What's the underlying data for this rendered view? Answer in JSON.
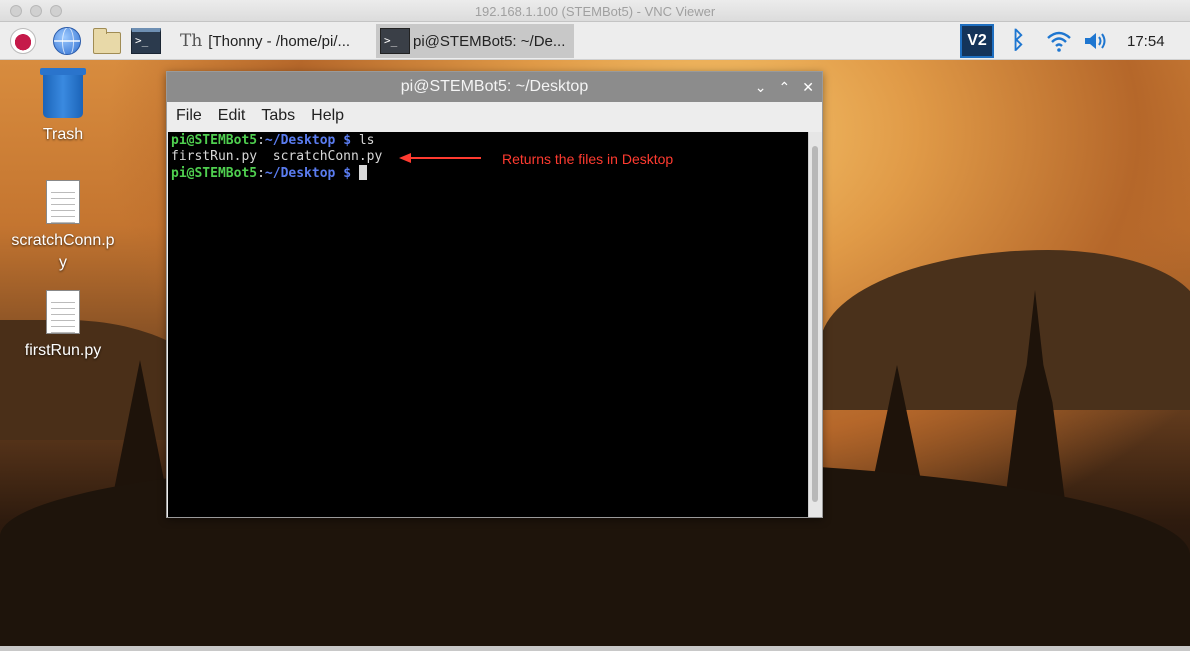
{
  "vnc": {
    "title": "192.168.1.100 (STEMBot5) - VNC Viewer"
  },
  "taskbar": {
    "icons": [
      "raspberry-menu-icon",
      "web-browser-icon",
      "file-manager-icon",
      "terminal-icon"
    ],
    "tasks": [
      {
        "label": "[Thonny  -  /home/pi/...",
        "active": false
      },
      {
        "label": "pi@STEMBot5: ~/De...",
        "active": true
      }
    ],
    "tray": {
      "vnc": "V2",
      "clock": "17:54"
    }
  },
  "desktop": {
    "icons": [
      {
        "label": "Trash",
        "icon": "trash-icon"
      },
      {
        "label": "scratchConn.py",
        "label_line1": "scratchConn.p",
        "label_line2": "y",
        "icon": "python-file-icon"
      },
      {
        "label": "firstRun.py",
        "icon": "python-file-icon"
      }
    ]
  },
  "terminal": {
    "title": "pi@STEMBot5: ~/Desktop",
    "menu": [
      "File",
      "Edit",
      "Tabs",
      "Help"
    ],
    "lines": [
      {
        "user": "pi@STEMBot5",
        "sep": ":",
        "path": "~/Desktop",
        "prompt": " $ ",
        "command": "ls"
      },
      {
        "output": "firstRun.py  scratchConn.py"
      },
      {
        "user": "pi@STEMBot5",
        "sep": ":",
        "path": "~/Desktop",
        "prompt": " $ ",
        "command": ""
      }
    ]
  },
  "annotation": {
    "text": "Returns the files in Desktop",
    "color": "#ff3b30"
  }
}
